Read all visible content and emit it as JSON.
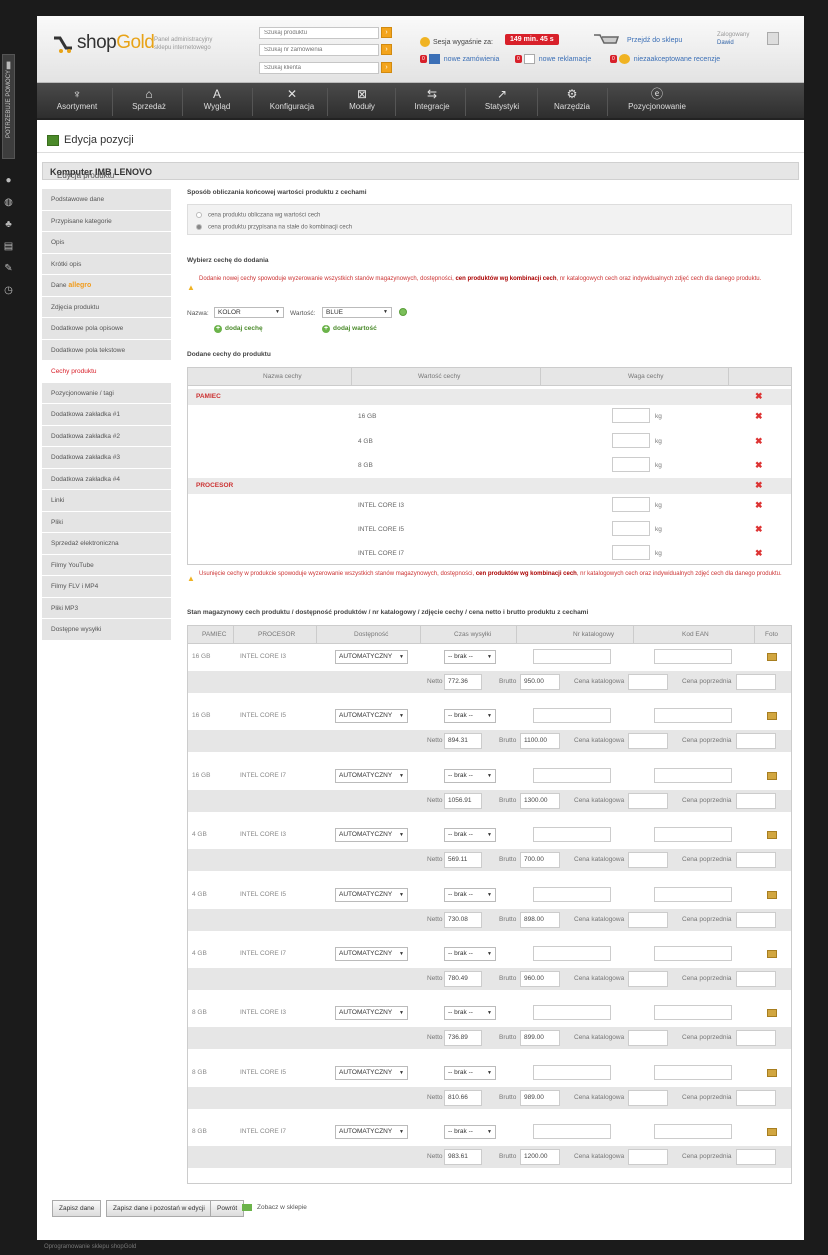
{
  "header": {
    "logo_prefix": "shop",
    "logo_suffix": "Gold",
    "panel_subtitle": "Panel administracyjny sklepu internetowego",
    "search_product_placeholder": "Szukaj produktu",
    "search_order_placeholder": "Szukaj nr zamówienia",
    "search_customer_placeholder": "Szukaj klienta",
    "session_label": "Sesja wygaśnie za:",
    "session_time": "149 min. 45 s",
    "go_to_shop": "Przejdź do sklepu",
    "logged_label": "Zalogowany",
    "logged_user": "Dawid",
    "notif_orders_count": "0",
    "notif_orders": "nowe zamówienia",
    "notif_complaints_count": "0",
    "notif_complaints": "nowe reklamacje",
    "notif_reviews_count": "0",
    "notif_reviews": "niezaakceptowane recenzje"
  },
  "nav": [
    "Asortyment",
    "Sprzedaż",
    "Wygląd",
    "Konfiguracja",
    "Moduły",
    "Integracje",
    "Statystyki",
    "Narzędzia",
    "Pozycjonowanie"
  ],
  "help_tab": "POTRZEBUJE POMOCY",
  "page_title": "Edycja pozycji",
  "product_label": "Edycja produktu",
  "product_name": "Komputer IMB LENOVO",
  "sidenav": [
    "Podstawowe dane",
    "Przypisane kategorie",
    "Opis",
    "Krótki opis",
    "Dane",
    "Zdjęcia produktu",
    "Dodatkowe pola opisowe",
    "Dodatkowe pola tekstowe",
    "Cechy produktu",
    "Pozycjonowanie / tagi",
    "Dodatkowa zakładka #1",
    "Dodatkowa zakładka #2",
    "Dodatkowa zakładka #3",
    "Dodatkowa zakładka #4",
    "Linki",
    "Pliki",
    "Sprzedaż elektroniczna",
    "Filmy YouTube",
    "Filmy FLV i MP4",
    "Pliki MP3",
    "Dostępne wysyłki"
  ],
  "sidenav_allegro": "allegro",
  "pricing": {
    "title": "Sposób obliczania końcowej wartości produktu z cechami",
    "opt1": "cena produktu obliczana wg wartości cech",
    "opt2": "cena produktu przypisana na stałe do kombinacji cech"
  },
  "choose": {
    "title": "Wybierz cechę do dodania",
    "warning_a": "Dodanie nowej cechy spowoduje wyzerowanie wszystkich stanów magazynowych, dostępności,",
    "warning_bold": "cen produktów wg kombinacji cech",
    "warning_b": ", nr katalogowych cech oraz indywidualnych zdjęć cech dla danego produktu.",
    "name_label": "Nazwa:",
    "name_value": "KOLOR",
    "value_label": "Wartość:",
    "value_value": "BLUE",
    "add_feature": "dodaj cechę",
    "add_value": "dodaj wartość"
  },
  "added": {
    "title": "Dodane cechy do produktu",
    "col_name": "Nazwa cechy",
    "col_value": "Wartość cechy",
    "col_weight": "Waga cechy",
    "unit": "kg",
    "groups": [
      {
        "name": "PAMIEC",
        "values": [
          "16 GB",
          "4 GB",
          "8 GB"
        ]
      },
      {
        "name": "PROCESOR",
        "values": [
          "INTEL CORE I3",
          "INTEL CORE I5",
          "INTEL CORE I7"
        ]
      }
    ]
  },
  "remove_warning": {
    "a": "Usunięcie cechy w produkcie spowoduje wyzerowanie wszystkich stanów magazynowych, dostępności,",
    "bold": "cen produktów wg kombinacji cech",
    "b": ", nr katalogowych cech oraz indywidualnych zdjęć cech dla danego produktu."
  },
  "stock": {
    "title": "Stan magazynowy cech produktu / dostępność produktów / nr katalogowy / zdjęcie cechy / cena netto i brutto produktu z cechami",
    "cols": [
      "PAMIEC",
      "PROCESOR",
      "Dostępność",
      "Czas wysyłki",
      "Nr katalogowy",
      "Kod EAN",
      "Foto"
    ],
    "availability": "AUTOMATYCZNY",
    "shipping": "-- brak --",
    "netto_label": "Netto",
    "brutto_label": "Brutto",
    "catalog_price_label": "Cena katalogowa",
    "prev_price_label": "Cena poprzednia",
    "rows": [
      {
        "mem": "16 GB",
        "cpu": "INTEL CORE I3",
        "netto": "772.36",
        "brutto": "950.00"
      },
      {
        "mem": "16 GB",
        "cpu": "INTEL CORE I5",
        "netto": "894.31",
        "brutto": "1100.00"
      },
      {
        "mem": "16 GB",
        "cpu": "INTEL CORE I7",
        "netto": "1056.91",
        "brutto": "1300.00"
      },
      {
        "mem": "4 GB",
        "cpu": "INTEL CORE I3",
        "netto": "569.11",
        "brutto": "700.00"
      },
      {
        "mem": "4 GB",
        "cpu": "INTEL CORE I5",
        "netto": "730.08",
        "brutto": "898.00"
      },
      {
        "mem": "4 GB",
        "cpu": "INTEL CORE I7",
        "netto": "780.49",
        "brutto": "960.00"
      },
      {
        "mem": "8 GB",
        "cpu": "INTEL CORE I3",
        "netto": "736.89",
        "brutto": "899.00"
      },
      {
        "mem": "8 GB",
        "cpu": "INTEL CORE I5",
        "netto": "810.66",
        "brutto": "989.00"
      },
      {
        "mem": "8 GB",
        "cpu": "INTEL CORE I7",
        "netto": "983.61",
        "brutto": "1200.00"
      }
    ]
  },
  "buttons": {
    "save": "Zapisz dane",
    "save_stay": "Zapisz dane i pozostań w edycji",
    "back": "Powrót",
    "see_in_shop": "Zobacz w sklepie"
  },
  "footer": "Oprogramowanie sklepu shopGold"
}
